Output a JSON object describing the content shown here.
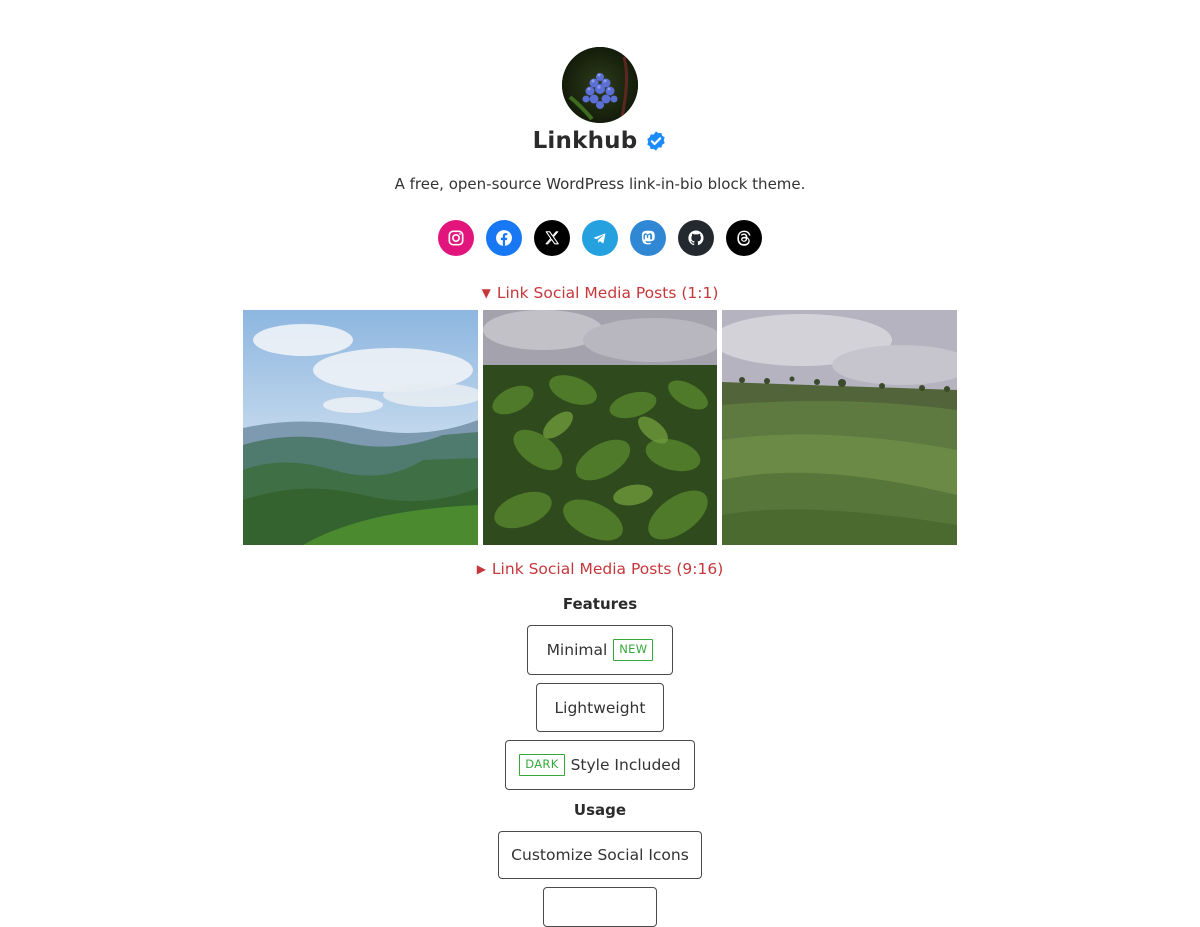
{
  "profile": {
    "name": "Linkhub",
    "bio": "A free, open-source WordPress link-in-bio block theme."
  },
  "socials": [
    {
      "icon": "instagram-icon",
      "color": "#e1157c"
    },
    {
      "icon": "facebook-icon",
      "color": "#1877f2"
    },
    {
      "icon": "x-icon",
      "color": "#000000"
    },
    {
      "icon": "telegram-icon",
      "color": "#24a1de"
    },
    {
      "icon": "mastodon-icon",
      "color": "#3088d4"
    },
    {
      "icon": "github-icon",
      "color": "#24292f"
    },
    {
      "icon": "threads-icon",
      "color": "#000000"
    }
  ],
  "details": [
    {
      "label": "Link Social Media Posts (1:1)",
      "marker": "▼"
    },
    {
      "label": "Link Social Media Posts (9:16)",
      "marker": "▶"
    }
  ],
  "features": {
    "title": "Features",
    "items": [
      {
        "label": "Minimal",
        "tag": "NEW"
      },
      {
        "label": "Lightweight"
      },
      {
        "label": "Style Included",
        "tag": "DARK"
      }
    ]
  },
  "usage": {
    "title": "Usage",
    "items": [
      {
        "label": "Customize Social Icons"
      },
      {
        "label": ""
      }
    ]
  },
  "colors": {
    "accent": "#c6373b",
    "tag": "#36a83a",
    "verified": "#1d8cf8"
  }
}
